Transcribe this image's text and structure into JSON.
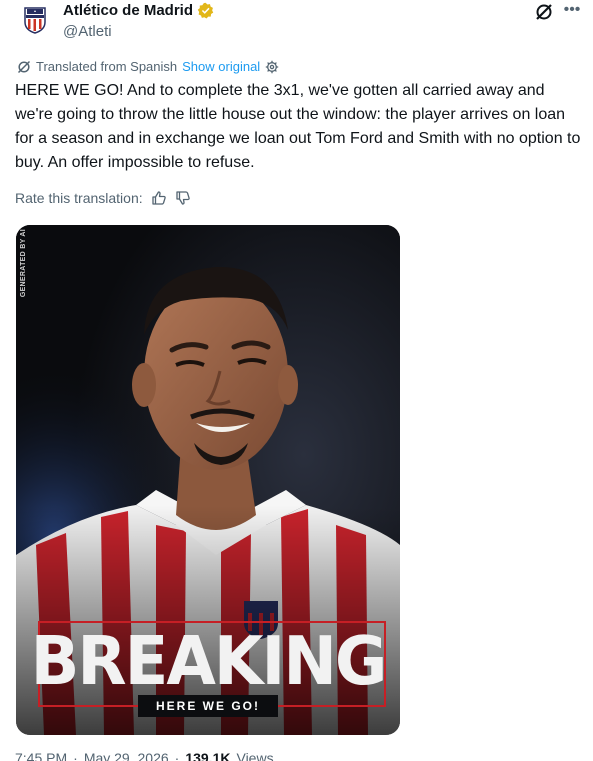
{
  "author": {
    "display_name": "Atlético de Madrid",
    "handle": "@Atleti",
    "verified_color": "#e2b719"
  },
  "translation": {
    "label": "Translated from Spanish",
    "show_original": "Show original"
  },
  "tweet": {
    "text": "HERE WE GO! And to complete the 3x1, we've gotten all carried away and we're going to throw the little house out the window: the player arrives on loan for a season and in exchange we loan out Tom Ford and Smith with no option to buy. An offer impossible to refuse."
  },
  "rate": {
    "label": "Rate this translation:"
  },
  "media": {
    "ai_tag": "GENERATED BY AI",
    "headline": "BREAKING",
    "subheadline": "HERE WE GO!",
    "accent_color": "#c61f25"
  },
  "footer": {
    "time": "7:45 PM",
    "separator": "·",
    "date": "May 29, 2026",
    "views_count": "139.1K",
    "views_label": "Views"
  },
  "colors": {
    "link": "#1d9bf0",
    "secondary_text": "#536471",
    "primary_text": "#0f1419"
  }
}
